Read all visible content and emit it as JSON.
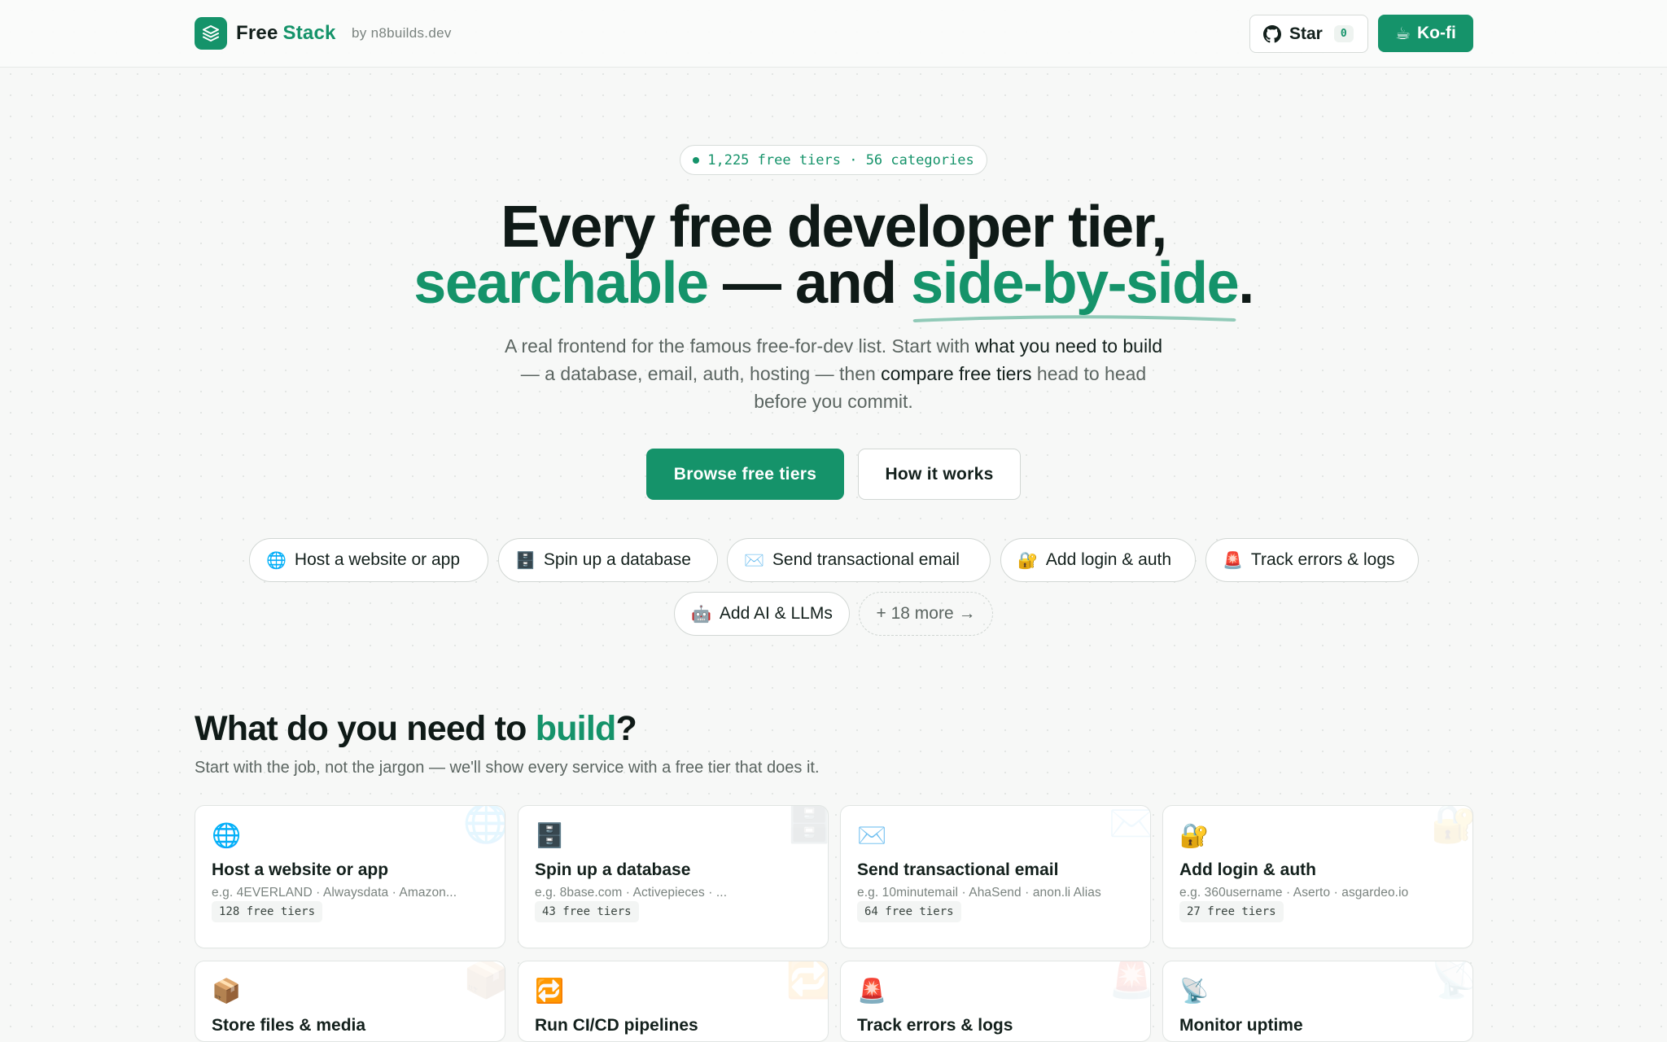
{
  "header": {
    "brand_first": "Free",
    "brand_second": "Stack",
    "by": "by n8builds.dev",
    "star_label": "Star",
    "star_count": "0",
    "kofi_label": "Ko-fi"
  },
  "hero": {
    "pill": "1,225 free tiers · 56 categories",
    "h1_line1": "Every free developer tier,",
    "h1_word_a": "searchable",
    "h1_mid": " — and ",
    "h1_word_b": "side-by-side",
    "h1_end": ".",
    "sub_1": "A real frontend for the famous free-for-dev list. Start with ",
    "sub_2": "what you need to build",
    "sub_3": " — a database, email, auth, hosting — then ",
    "sub_4": "compare free tiers",
    "sub_5": " head to head before you commit.",
    "cta_primary": "Browse free tiers",
    "cta_secondary": "How it works",
    "chips": [
      {
        "emoji": "🌐",
        "label": "Host a website or app"
      },
      {
        "emoji": "🗄️",
        "label": "Spin up a database"
      },
      {
        "emoji": "✉️",
        "label": "Send transactional email"
      },
      {
        "emoji": "🔐",
        "label": "Add login & auth"
      },
      {
        "emoji": "🚨",
        "label": "Track errors & logs"
      },
      {
        "emoji": "🤖",
        "label": "Add AI & LLMs"
      }
    ],
    "more_chip": "+ 18 more →"
  },
  "section": {
    "title_a": "What do you need to ",
    "title_b": "build",
    "title_c": "?",
    "subtitle": "Start with the job, not the jargon — we'll show every service with a free tier that does it."
  },
  "cards": [
    {
      "emoji": "🌐",
      "title": "Host a website or app",
      "examples": "e.g. 4EVERLAND · Alwaysdata · Amazon...",
      "count": "128 free tiers"
    },
    {
      "emoji": "🗄️",
      "title": "Spin up a database",
      "examples": "e.g. 8base.com · Activepieces · ...",
      "count": "43 free tiers"
    },
    {
      "emoji": "✉️",
      "title": "Send transactional email",
      "examples": "e.g. 10minutemail · AhaSend · anon.li Alias",
      "count": "64 free tiers"
    },
    {
      "emoji": "🔐",
      "title": "Add login & auth",
      "examples": "e.g. 360username · Aserto · asgardeo.io",
      "count": "27 free tiers"
    },
    {
      "emoji": "📦",
      "title": "Store files & media"
    },
    {
      "emoji": "🔁",
      "title": "Run CI/CD pipelines"
    },
    {
      "emoji": "🚨",
      "title": "Track errors & logs"
    },
    {
      "emoji": "📡",
      "title": "Monitor uptime"
    }
  ]
}
